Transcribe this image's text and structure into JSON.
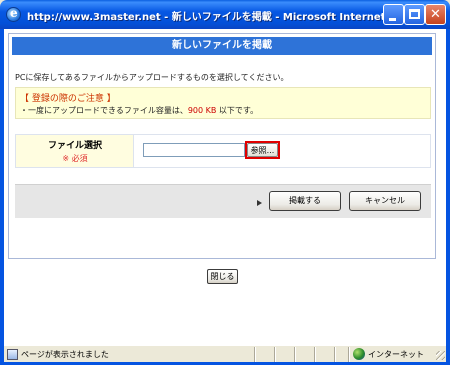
{
  "window": {
    "title": "http://www.3master.net - 新しいファイルを掲載 - Microsoft Internet Explorer",
    "controls": [
      "minimize",
      "maximize",
      "close"
    ]
  },
  "dialog": {
    "heading": "新しいファイルを掲載",
    "instruction": "PCに保存してあるファイルからアップロードするものを選択してください。",
    "notice": {
      "title": "【 登録の際のご注意 】",
      "body_prefix": "・一度にアップロードできるファイル容量は、",
      "body_limit": "900 KB",
      "body_suffix": " 以下です。"
    },
    "file_field": {
      "label": "ファイル選択",
      "required": "※ 必須",
      "value": "",
      "browse_label": "参照..."
    },
    "actions": {
      "submit_label": "掲載する",
      "cancel_label": "キャンセル"
    }
  },
  "close_label": "閉じる",
  "statusbar": {
    "status_text": "ページが表示されました",
    "zone_text": "インターネット"
  },
  "colors": {
    "titlebar": "#0554e1",
    "header": "#2e73d8",
    "notice_bg": "#ffffd7",
    "notice_title": "#cc3300",
    "required": "#e03030",
    "highlight_border": "#e00000"
  },
  "icons": {
    "app": "ie-icon",
    "status": "page-icon",
    "zone": "internet-globe-icon"
  }
}
